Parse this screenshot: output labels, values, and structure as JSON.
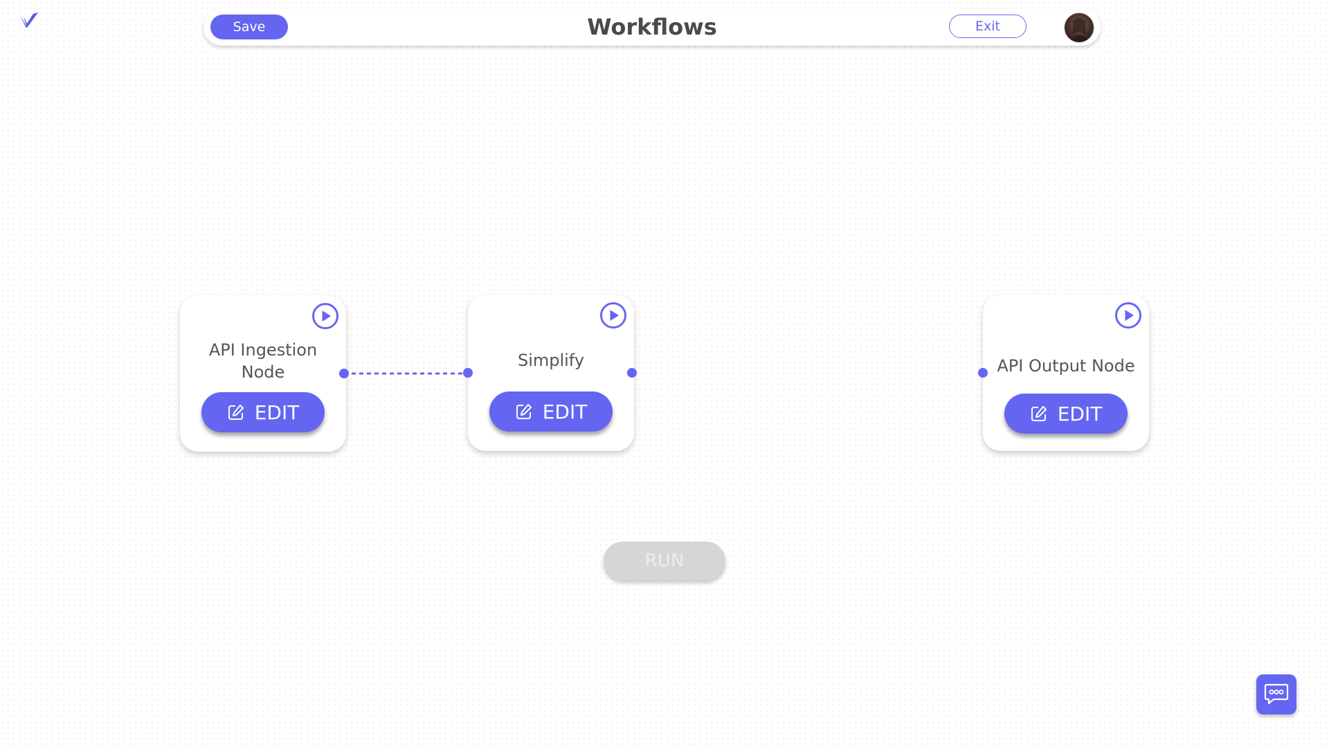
{
  "app": {
    "logo_icon": "v-logo-icon",
    "accent_color": "#6466f1"
  },
  "header": {
    "title": "Workflows",
    "save_label": "Save",
    "exit_label": "Exit",
    "avatar_icon": "user-avatar"
  },
  "nodes": [
    {
      "label": "API Ingestion Node",
      "edit_label": "EDIT",
      "run_icon": "play-circle-icon",
      "edit_icon": "edit-pencil-icon"
    },
    {
      "label": "Simplify",
      "edit_label": "EDIT",
      "run_icon": "play-circle-icon",
      "edit_icon": "edit-pencil-icon"
    },
    {
      "label": "API Output Node",
      "edit_label": "EDIT",
      "run_icon": "play-circle-icon",
      "edit_icon": "edit-pencil-icon"
    }
  ],
  "connections": [
    {
      "from": "API Ingestion Node",
      "to": "Simplify",
      "style": "dashed"
    }
  ],
  "run": {
    "label": "RUN",
    "disabled": true
  },
  "chat": {
    "icon": "chat-bubble-icon"
  }
}
